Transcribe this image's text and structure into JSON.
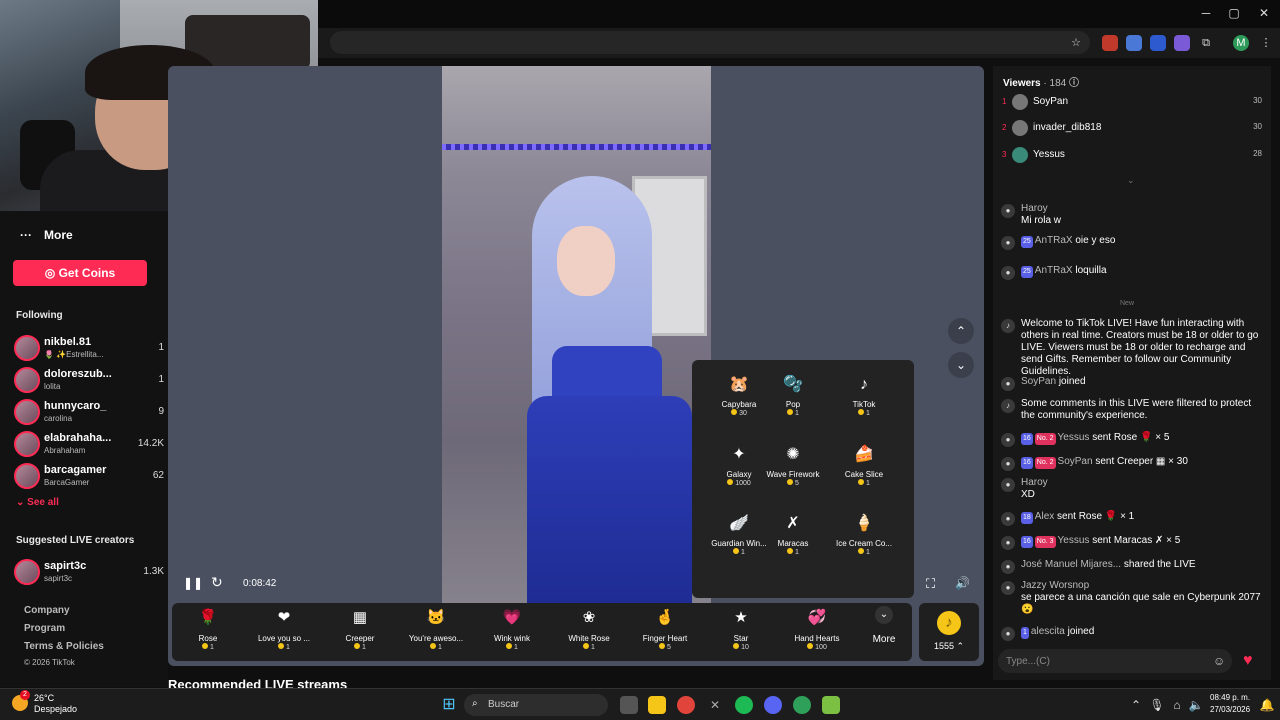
{
  "window": {
    "minimize": "─",
    "restore": "▢",
    "close": "✕"
  },
  "browser": {
    "extensions": [
      "bookmark-star",
      "ext-red",
      "ext-translate",
      "ext-blue",
      "ext-purple",
      "puzzle-icon"
    ],
    "profile_initial": "M",
    "menu": "⋮"
  },
  "sidebar": {
    "more_label": "More",
    "get_coins": "Get Coins",
    "following_header": "Following",
    "following": [
      {
        "name": "nikbel.81",
        "sub": "🌷 ✨Estrellita...",
        "count": "1"
      },
      {
        "name": "doloreszub...",
        "sub": "lolita",
        "count": "1"
      },
      {
        "name": "hunnycaro_",
        "sub": "carolina",
        "count": "9"
      },
      {
        "name": "elabrahaha...",
        "sub": "Abrahaham",
        "count": "14.2K"
      },
      {
        "name": "barcagamer",
        "sub": "BarcaGamer",
        "count": "62"
      }
    ],
    "see_all": "See all",
    "suggested_header": "Suggested LIVE creators",
    "suggested": [
      {
        "name": "sapirt3c",
        "sub": "sapirt3c",
        "count": "1.3K"
      }
    ],
    "footer": [
      "Company",
      "Program",
      "Terms & Policies",
      "© 2026 TikTok"
    ]
  },
  "player": {
    "time": "0:08:42"
  },
  "gift_panel": [
    {
      "name": "Capybara",
      "price": "30",
      "icon": "🐹"
    },
    {
      "name": "Pop",
      "price": "1",
      "icon": "🫧"
    },
    {
      "name": "TikTok",
      "price": "1",
      "icon": "♪"
    },
    {
      "name": "Galaxy",
      "price": "1000",
      "icon": "✦"
    },
    {
      "name": "Wave Firework",
      "price": "5",
      "icon": "✺"
    },
    {
      "name": "Cake Slice",
      "price": "1",
      "icon": "🍰"
    },
    {
      "name": "Guardian Win...",
      "price": "1",
      "icon": "🪽"
    },
    {
      "name": "Maracas",
      "price": "1",
      "icon": "✗"
    },
    {
      "name": "Ice Cream Co...",
      "price": "1",
      "icon": "🍦"
    }
  ],
  "gift_bar": [
    {
      "name": "Rose",
      "price": "1",
      "icon": "🌹"
    },
    {
      "name": "Love you so ...",
      "price": "1",
      "icon": "❤"
    },
    {
      "name": "Creeper",
      "price": "1",
      "icon": "▦"
    },
    {
      "name": "You're aweso...",
      "price": "1",
      "icon": "🐱"
    },
    {
      "name": "Wink wink",
      "price": "1",
      "icon": "💗"
    },
    {
      "name": "White Rose",
      "price": "1",
      "icon": "❀"
    },
    {
      "name": "Finger Heart",
      "price": "5",
      "icon": "🤞"
    },
    {
      "name": "Star",
      "price": "10",
      "icon": "★"
    },
    {
      "name": "Hand Hearts",
      "price": "100",
      "icon": "💞"
    }
  ],
  "gift_more": "More",
  "balance": "1555",
  "recommended": "Recommended LIVE streams",
  "chat": {
    "viewers_label": "Viewers",
    "viewers_count": "· 184",
    "top_viewers": [
      {
        "rank": "1",
        "name": "SoyPan",
        "score": "30"
      },
      {
        "rank": "2",
        "name": "invader_dib818",
        "score": "30"
      },
      {
        "rank": "3",
        "name": "Yessus",
        "score": "28"
      }
    ],
    "new_label": "New",
    "messages": [
      {
        "user": "Haroy",
        "text": "Mi rola w"
      },
      {
        "badge": "25",
        "user": "AnTRaX",
        "text": "oie y eso"
      },
      {
        "badge": "25",
        "user": "AnTRaX",
        "text": "loquilla"
      },
      {
        "text": "Welcome to TikTok LIVE! Have fun interacting with others in real time. Creators must be 18 or older to go LIVE. Viewers must be 18 or older to recharge and send Gifts. Remember to follow our Community Guidelines."
      },
      {
        "user": "SoyPan",
        "text": "joined"
      },
      {
        "text": "Some comments in this LIVE were filtered to protect the community's experience."
      },
      {
        "badge": "16",
        "user": "Yessus",
        "rank": "No. 2",
        "text": "sent Rose 🌹 × 5"
      },
      {
        "badge": "16",
        "user": "SoyPan",
        "rank": "No. 2",
        "text": "sent Creeper ▦ × 30"
      },
      {
        "user": "Haroy",
        "text": "XD"
      },
      {
        "badge": "18",
        "user": "Alex",
        "text": "sent Rose 🌹 × 1"
      },
      {
        "badge": "16",
        "user": "Yessus",
        "rank": "No. 3",
        "text": "sent Maracas ✗ × 5"
      },
      {
        "user": "José Manuel Mijares...",
        "text": "shared the LIVE"
      },
      {
        "user": "Jazzy Worsnop",
        "text": "se parece a una canción que sale en Cyberpunk 2077 😮"
      },
      {
        "badge": "1",
        "user": "alescita",
        "text": "joined"
      }
    ],
    "input_placeholder": "Type...(C)"
  },
  "taskbar": {
    "temp": "26°C",
    "weather": "Despejado",
    "search_placeholder": "Buscar",
    "notif": "2",
    "time": "08:49 p. m.",
    "date": "27/03/2026"
  }
}
